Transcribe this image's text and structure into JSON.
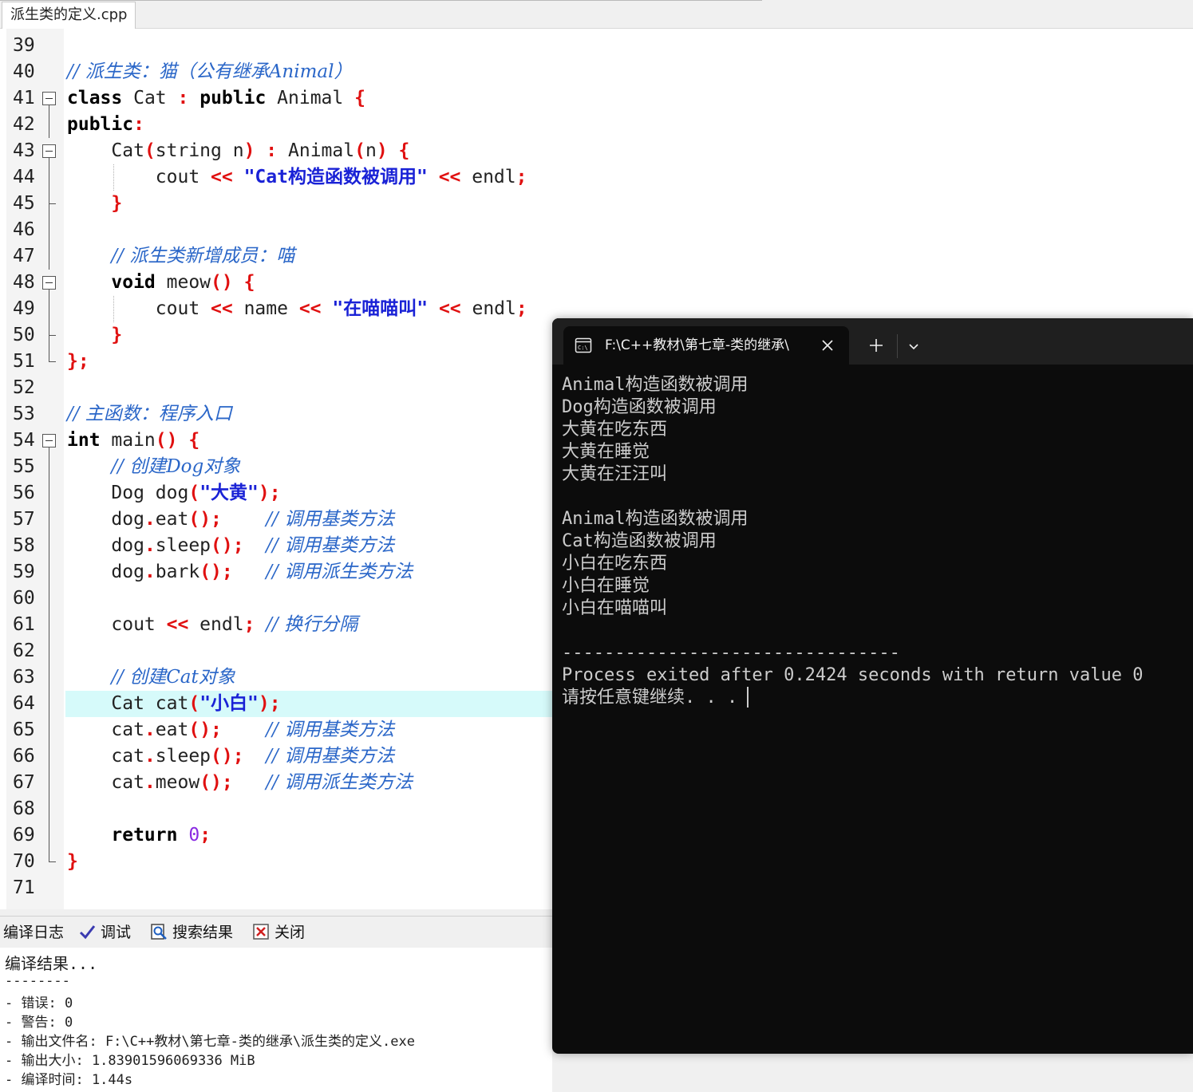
{
  "file_tab": {
    "label": "派生类的定义.cpp"
  },
  "editor": {
    "lines": [
      {
        "n": "39",
        "code": []
      },
      {
        "n": "40",
        "code": [
          {
            "t": "// 派生类：猫（公有继承Animal）",
            "c": "cm"
          }
        ]
      },
      {
        "n": "41",
        "code": [
          {
            "t": "class",
            "c": "kw"
          },
          {
            "t": " Cat ",
            "c": ""
          },
          {
            "t": ":",
            "c": "op"
          },
          {
            "t": " ",
            "c": ""
          },
          {
            "t": "public",
            "c": "kw"
          },
          {
            "t": " Animal ",
            "c": ""
          },
          {
            "t": "{",
            "c": "op"
          }
        ]
      },
      {
        "n": "42",
        "code": [
          {
            "t": "public",
            "c": "kw"
          },
          {
            "t": ":",
            "c": "op"
          }
        ]
      },
      {
        "n": "43",
        "code": [
          {
            "t": "    Cat",
            "c": ""
          },
          {
            "t": "(",
            "c": "op"
          },
          {
            "t": "string n",
            "c": ""
          },
          {
            "t": ")",
            "c": "op"
          },
          {
            "t": " ",
            "c": ""
          },
          {
            "t": ":",
            "c": "op"
          },
          {
            "t": " Animal",
            "c": ""
          },
          {
            "t": "(",
            "c": "op"
          },
          {
            "t": "n",
            "c": ""
          },
          {
            "t": ")",
            "c": "op"
          },
          {
            "t": " ",
            "c": ""
          },
          {
            "t": "{",
            "c": "op"
          }
        ]
      },
      {
        "n": "44",
        "code": [
          {
            "t": "        cout ",
            "c": ""
          },
          {
            "t": "<<",
            "c": "op"
          },
          {
            "t": " ",
            "c": ""
          },
          {
            "t": "\"Cat构造函数被调用\"",
            "c": "str"
          },
          {
            "t": " ",
            "c": ""
          },
          {
            "t": "<<",
            "c": "op"
          },
          {
            "t": " endl",
            "c": ""
          },
          {
            "t": ";",
            "c": "op"
          }
        ]
      },
      {
        "n": "45",
        "code": [
          {
            "t": "    ",
            "c": ""
          },
          {
            "t": "}",
            "c": "op"
          }
        ]
      },
      {
        "n": "46",
        "code": []
      },
      {
        "n": "47",
        "code": [
          {
            "t": "    ",
            "c": ""
          },
          {
            "t": "// 派生类新增成员：喵",
            "c": "cm"
          }
        ]
      },
      {
        "n": "48",
        "code": [
          {
            "t": "    ",
            "c": ""
          },
          {
            "t": "void",
            "c": "kw"
          },
          {
            "t": " meow",
            "c": ""
          },
          {
            "t": "()",
            "c": "op"
          },
          {
            "t": " ",
            "c": ""
          },
          {
            "t": "{",
            "c": "op"
          }
        ]
      },
      {
        "n": "49",
        "code": [
          {
            "t": "        cout ",
            "c": ""
          },
          {
            "t": "<<",
            "c": "op"
          },
          {
            "t": " name ",
            "c": ""
          },
          {
            "t": "<<",
            "c": "op"
          },
          {
            "t": " ",
            "c": ""
          },
          {
            "t": "\"在喵喵叫\"",
            "c": "str"
          },
          {
            "t": " ",
            "c": ""
          },
          {
            "t": "<<",
            "c": "op"
          },
          {
            "t": " endl",
            "c": ""
          },
          {
            "t": ";",
            "c": "op"
          }
        ]
      },
      {
        "n": "50",
        "code": [
          {
            "t": "    ",
            "c": ""
          },
          {
            "t": "}",
            "c": "op"
          }
        ]
      },
      {
        "n": "51",
        "code": [
          {
            "t": "};",
            "c": "op"
          }
        ]
      },
      {
        "n": "52",
        "code": []
      },
      {
        "n": "53",
        "code": [
          {
            "t": "// 主函数：程序入口",
            "c": "cm"
          }
        ]
      },
      {
        "n": "54",
        "code": [
          {
            "t": "int",
            "c": "kw"
          },
          {
            "t": " main",
            "c": ""
          },
          {
            "t": "()",
            "c": "op"
          },
          {
            "t": " ",
            "c": ""
          },
          {
            "t": "{",
            "c": "op"
          }
        ]
      },
      {
        "n": "55",
        "code": [
          {
            "t": "    ",
            "c": ""
          },
          {
            "t": "// 创建Dog对象",
            "c": "cm"
          }
        ]
      },
      {
        "n": "56",
        "code": [
          {
            "t": "    Dog dog",
            "c": ""
          },
          {
            "t": "(",
            "c": "op"
          },
          {
            "t": "\"大黄\"",
            "c": "str"
          },
          {
            "t": ");",
            "c": "op"
          }
        ]
      },
      {
        "n": "57",
        "code": [
          {
            "t": "    dog",
            "c": ""
          },
          {
            "t": ".",
            "c": "op"
          },
          {
            "t": "eat",
            "c": ""
          },
          {
            "t": "();",
            "c": "op"
          },
          {
            "t": "    ",
            "c": ""
          },
          {
            "t": "// 调用基类方法",
            "c": "cm"
          }
        ]
      },
      {
        "n": "58",
        "code": [
          {
            "t": "    dog",
            "c": ""
          },
          {
            "t": ".",
            "c": "op"
          },
          {
            "t": "sleep",
            "c": ""
          },
          {
            "t": "();",
            "c": "op"
          },
          {
            "t": "  ",
            "c": ""
          },
          {
            "t": "// 调用基类方法",
            "c": "cm"
          }
        ]
      },
      {
        "n": "59",
        "code": [
          {
            "t": "    dog",
            "c": ""
          },
          {
            "t": ".",
            "c": "op"
          },
          {
            "t": "bark",
            "c": ""
          },
          {
            "t": "();",
            "c": "op"
          },
          {
            "t": "   ",
            "c": ""
          },
          {
            "t": "// 调用派生类方法",
            "c": "cm"
          }
        ]
      },
      {
        "n": "60",
        "code": []
      },
      {
        "n": "61",
        "code": [
          {
            "t": "    cout ",
            "c": ""
          },
          {
            "t": "<<",
            "c": "op"
          },
          {
            "t": " endl",
            "c": ""
          },
          {
            "t": ";",
            "c": "op"
          },
          {
            "t": " ",
            "c": ""
          },
          {
            "t": "// 换行分隔",
            "c": "cm"
          }
        ]
      },
      {
        "n": "62",
        "code": []
      },
      {
        "n": "63",
        "code": [
          {
            "t": "    ",
            "c": ""
          },
          {
            "t": "// 创建Cat对象",
            "c": "cm"
          }
        ]
      },
      {
        "n": "64",
        "code": [
          {
            "t": "    Cat cat",
            "c": ""
          },
          {
            "t": "(",
            "c": "op"
          },
          {
            "t": "\"小白\"",
            "c": "str"
          },
          {
            "t": ");",
            "c": "op"
          }
        ]
      },
      {
        "n": "65",
        "code": [
          {
            "t": "    cat",
            "c": ""
          },
          {
            "t": ".",
            "c": "op"
          },
          {
            "t": "eat",
            "c": ""
          },
          {
            "t": "();",
            "c": "op"
          },
          {
            "t": "    ",
            "c": ""
          },
          {
            "t": "// 调用基类方法",
            "c": "cm"
          }
        ]
      },
      {
        "n": "66",
        "code": [
          {
            "t": "    cat",
            "c": ""
          },
          {
            "t": ".",
            "c": "op"
          },
          {
            "t": "sleep",
            "c": ""
          },
          {
            "t": "();",
            "c": "op"
          },
          {
            "t": "  ",
            "c": ""
          },
          {
            "t": "// 调用基类方法",
            "c": "cm"
          }
        ]
      },
      {
        "n": "67",
        "code": [
          {
            "t": "    cat",
            "c": ""
          },
          {
            "t": ".",
            "c": "op"
          },
          {
            "t": "meow",
            "c": ""
          },
          {
            "t": "();",
            "c": "op"
          },
          {
            "t": "   ",
            "c": ""
          },
          {
            "t": "// 调用派生类方法",
            "c": "cm"
          }
        ]
      },
      {
        "n": "68",
        "code": []
      },
      {
        "n": "69",
        "code": [
          {
            "t": "    ",
            "c": ""
          },
          {
            "t": "return",
            "c": "kw"
          },
          {
            "t": " ",
            "c": ""
          },
          {
            "t": "0",
            "c": "num"
          },
          {
            "t": ";",
            "c": "op"
          }
        ]
      },
      {
        "n": "70",
        "code": [
          {
            "t": "}",
            "c": "op"
          }
        ]
      },
      {
        "n": "71",
        "code": []
      }
    ],
    "highlighted_line": "64"
  },
  "bottom_tabs": {
    "compile_log": "编译日志",
    "debug": "调试",
    "search_results": "搜索结果",
    "close": "关闭"
  },
  "compile_log": {
    "lines": [
      "编译结果...",
      "--------",
      "- 错误: 0",
      "- 警告: 0",
      "- 输出文件名: F:\\C++教材\\第七章-类的继承\\派生类的定义.exe",
      "- 输出大小: 1.83901596069336 MiB",
      "- 编译时间: 1.44s"
    ]
  },
  "terminal": {
    "tab_title": "F:\\C++教材\\第七章-类的继承\\",
    "new_tab_icon": "plus-icon",
    "dropdown_icon": "chevron-down-icon",
    "output": [
      "Animal构造函数被调用",
      "Dog构造函数被调用",
      "大黄在吃东西",
      "大黄在睡觉",
      "大黄在汪汪叫",
      "",
      "Animal构造函数被调用",
      "Cat构造函数被调用",
      "小白在吃东西",
      "小白在睡觉",
      "小白在喵喵叫",
      "",
      "--------------------------------",
      "Process exited after 0.2424 seconds with return value 0",
      "请按任意键继续. . ."
    ]
  },
  "colors": {
    "keyword": "#000000",
    "operator": "#e01010",
    "string": "#1a22d6",
    "comment": "#2a66c8",
    "number": "#8a2be2",
    "current_line": "#d6fafa",
    "terminal_bg": "#0c0c0c",
    "terminal_text": "#cccccc"
  }
}
